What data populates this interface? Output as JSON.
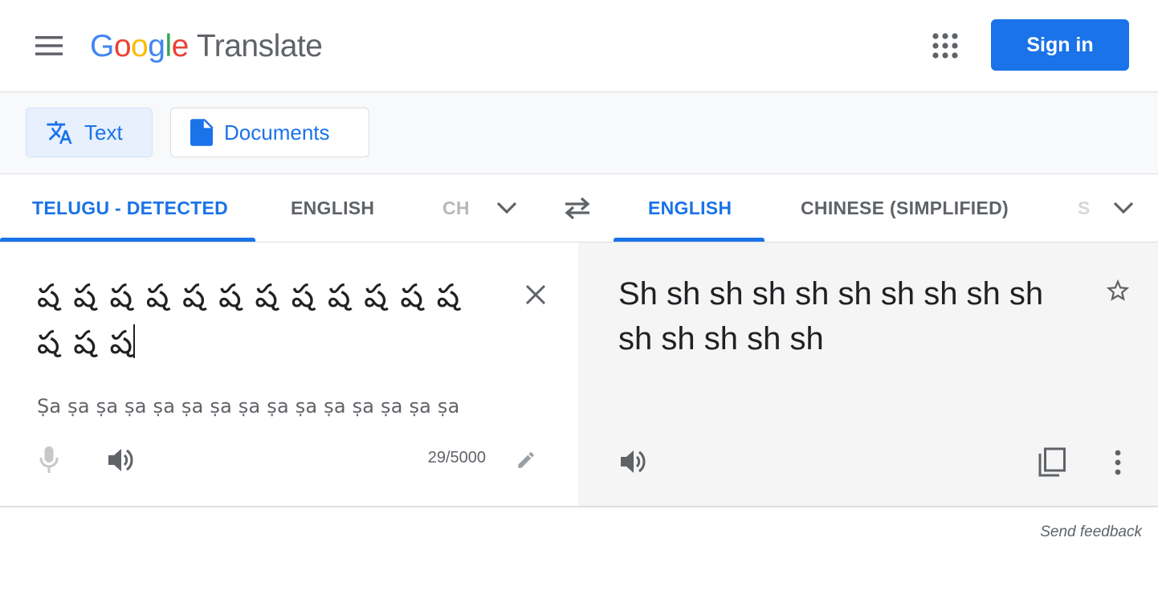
{
  "header": {
    "logo_letters": [
      "G",
      "o",
      "o",
      "g",
      "l",
      "e"
    ],
    "logo_colors": [
      "#4285F4",
      "#EA4335",
      "#FBBC05",
      "#4285F4",
      "#34A853",
      "#EA4335"
    ],
    "product_name": "Translate",
    "sign_in_label": "Sign in",
    "icons": [
      "menu-icon",
      "apps-grid-icon"
    ]
  },
  "modes": {
    "text_label": "Text",
    "documents_label": "Documents",
    "selected": "Text"
  },
  "source_languages": {
    "detected_label": "TELUGU - DETECTED",
    "english_label": "ENGLISH",
    "partial_label": "CH",
    "selected": "TELUGU - DETECTED"
  },
  "target_languages": {
    "english_label": "ENGLISH",
    "chinese_label": "CHINESE (SIMPLIFIED)",
    "partial_label": "S",
    "selected": "ENGLISH"
  },
  "source": {
    "text": "ష ష ష ష ష ష ష ష ష ష ష ష ష ష ష",
    "transliteration": "Ṣa ṣa ṣa ṣa ṣa ṣa ṣa ṣa ṣa ṣa ṣa ṣa ṣa ṣa ṣa",
    "char_count": "29/5000"
  },
  "target": {
    "text": "Sh sh sh sh sh sh sh sh sh sh sh sh sh sh sh"
  },
  "footer": {
    "feedback_label": "Send feedback"
  },
  "colors": {
    "accent": "#1a73e8",
    "active_tab_bg": "#e8f0fe",
    "target_panel_bg": "#f5f5f5",
    "icon_grey": "#5f6368"
  }
}
